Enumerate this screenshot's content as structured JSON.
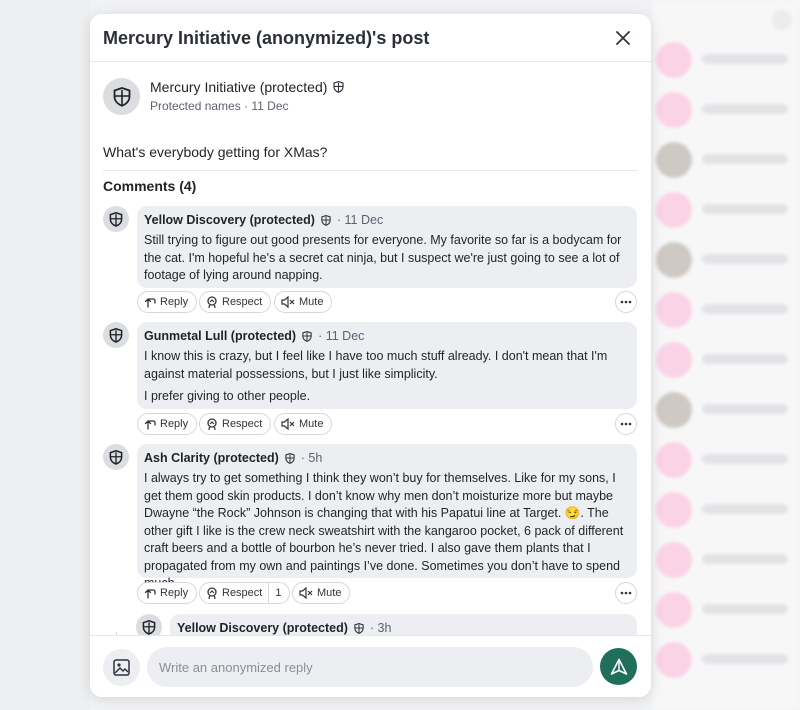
{
  "modal": {
    "title": "Mercury Initiative (anonymized)'s post"
  },
  "post": {
    "author": "Mercury Initiative (protected)",
    "meta": "Protected names · 11 Dec",
    "text": "What's everybody getting for XMas?"
  },
  "comments_heading": "Comments (4)",
  "comments": [
    {
      "author": "Yellow Discovery (protected)",
      "time": "· 11 Dec",
      "paragraphs": [
        "Still trying to figure out good presents for everyone. My favorite so far is a bodycam for the cat. I'm hopeful he's a secret cat ninja, but I suspect we're just going to see a lot of footage of lying around napping."
      ],
      "actions": {
        "reply": "Reply",
        "respect": "Respect",
        "mute": "Mute"
      }
    },
    {
      "author": "Gunmetal Lull (protected)",
      "time": "· 11 Dec",
      "paragraphs": [
        "I know this is crazy, but I feel like I have too much stuff already. I don't mean that I'm against material possessions, but I just like simplicity.",
        "I prefer giving to other people."
      ],
      "actions": {
        "reply": "Reply",
        "respect": "Respect",
        "mute": "Mute"
      }
    },
    {
      "author": "Ash Clarity (protected)",
      "time": "· 5h",
      "paragraphs": [
        "I always try to get something I think they won’t buy for themselves. Like for my sons, I get them good skin products. I don’t know why men don’t moisturize more but maybe Dwayne “the Rock” Johnson is changing that with his Papatui line at Target. 😏. The other gift I like is the crew neck sweatshirt with the kangaroo pocket, 6 pack of different craft beers and a bottle of bourbon he’s never tried. I also gave them plants that I propagated from my own and paintings I’ve done. Sometimes you don’t have to spend much."
      ],
      "actions": {
        "reply": "Reply",
        "respect": "Respect",
        "respect_count": "1",
        "mute": "Mute"
      }
    },
    {
      "author": "Yellow Discovery (protected)",
      "time": "· 3h"
    }
  ],
  "reply_bar": {
    "placeholder": "Write an anonymized reply"
  },
  "colors": {
    "send_button": "#1f6f5b",
    "bubble": "#eceef1",
    "background_avatar_pink": "#fbd3e6"
  }
}
